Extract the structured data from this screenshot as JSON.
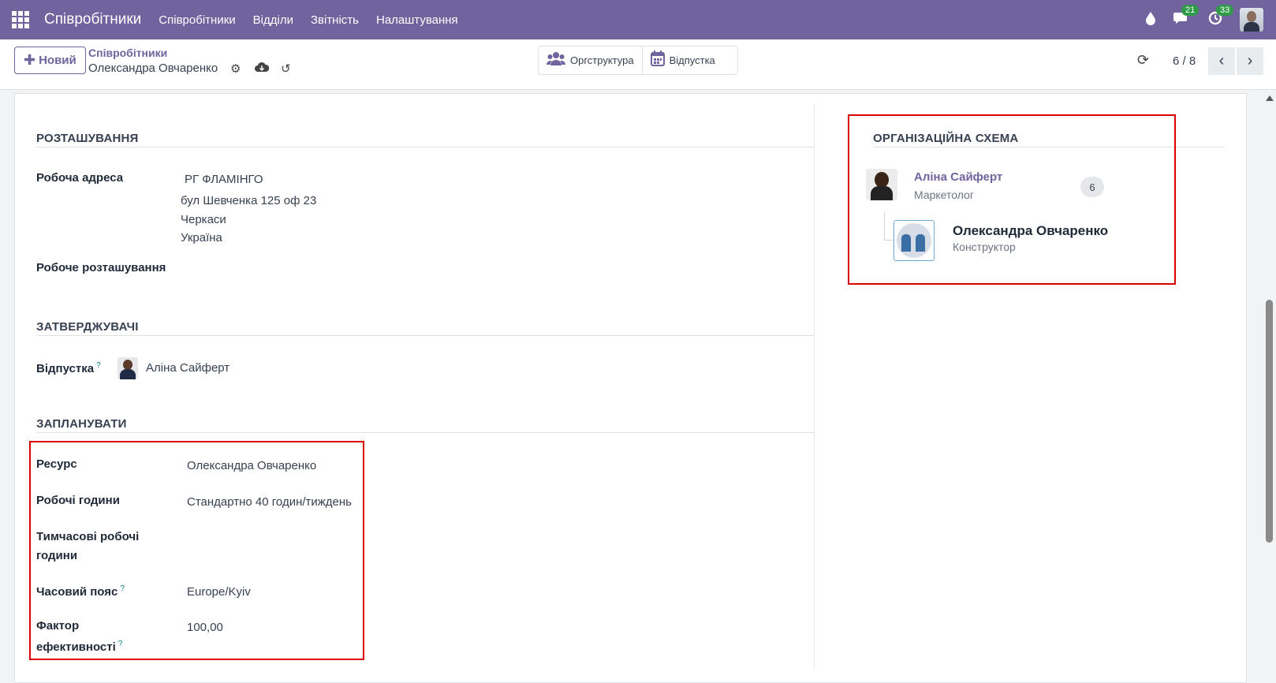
{
  "topnav": {
    "app_title": "Співробітники",
    "menu": [
      "Співробітники",
      "Відділи",
      "Звітність",
      "Налаштування"
    ],
    "messages_count": "21",
    "activities_count": "33",
    "colors": {
      "brand": "#71639e",
      "badge": "#2f9a48",
      "highlight": "#dd0000"
    }
  },
  "control_panel": {
    "new_label": "Новий",
    "breadcrumb_parent": "Співробітники",
    "breadcrumb_current": "Олександра Овчаренко",
    "smart_buttons": [
      "Оргструктура",
      "Відпустка"
    ],
    "pager": "6 / 8"
  },
  "location": {
    "title": "РОЗТАШУВАННЯ",
    "work_address_label": "Робоча адреса",
    "work_address": [
      "РГ ФЛАМІНГО",
      "бул Шевченка 125 оф 23",
      "Черкаси",
      "Україна"
    ],
    "work_location_label": "Робоче розташування"
  },
  "approvers": {
    "title": "ЗАТВЕРДЖУВАЧІ",
    "time_off_label": "Відпустка",
    "time_off_value": "Аліна Сайферт"
  },
  "planning": {
    "title": "ЗАПЛАНУВАТИ",
    "resource_label": "Ресурс",
    "resource_value": "Олександра Овчаренко",
    "working_hours_label": "Робочі години",
    "working_hours_value": "Стандартно 40 годин/тиждень",
    "temp_hours_label_1": "Тимчасові робочі",
    "temp_hours_label_2": "години",
    "timezone_label": "Часовий пояс",
    "timezone_value": "Europe/Kyiv",
    "efficiency_label_1": "Фактор",
    "efficiency_label_2": "ефективності",
    "efficiency_value": "100,00"
  },
  "org_chart": {
    "title": "ОРГАНІЗАЦІЙНА СХЕМА",
    "manager_name": "Аліна Сайферт",
    "manager_job": "Маркетолог",
    "subordinates_count": "6",
    "employee_name": "Олександра Овчаренко",
    "employee_job": "Конструктор"
  }
}
